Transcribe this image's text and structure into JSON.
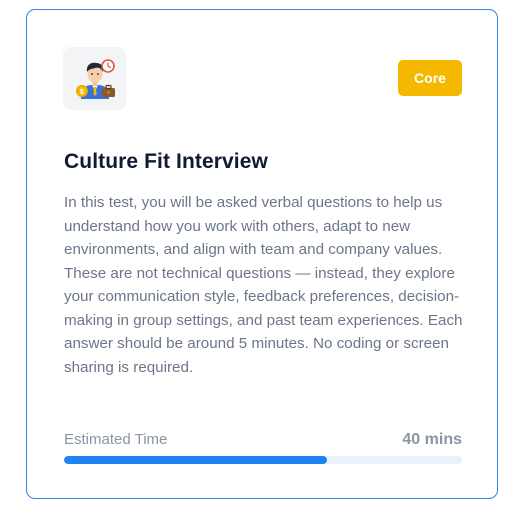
{
  "card": {
    "icon": "businessman-icon",
    "badge": "Core",
    "title": "Culture Fit Interview",
    "description": "In this test, you will be asked verbal questions to help us understand how you work with others, adapt to new environments, and align with team and company values. These are not technical questions — instead, they explore your communication style, feedback preferences, decision-making in group settings, and past team experiences. Each answer should be around 5 minutes. No coding or screen sharing is required.",
    "estimated_time_label": "Estimated Time",
    "estimated_time_value": "40 mins",
    "progress_fraction": 0.66
  },
  "colors": {
    "border": "#2f86e6",
    "badge_bg": "#f5b800",
    "progress_fill": "#1f84ef",
    "progress_track": "#e8f1fc",
    "title": "#111a33",
    "body_text": "#6b7689"
  }
}
